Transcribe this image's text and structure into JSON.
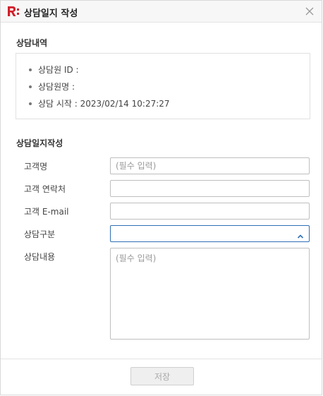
{
  "window": {
    "title": "상담일지 작성",
    "logo_icon": "r-logo-icon",
    "close_icon": "close-icon",
    "brand_color": "#d0202a",
    "accent_color": "#2f6fb5"
  },
  "consult_info": {
    "section_title": "상담내역",
    "items": [
      "상담원 ID :",
      "상담원명 :",
      "상담 시작 : 2023/02/14 10:27:27"
    ]
  },
  "consult_form": {
    "section_title": "상담일지작성",
    "customer_name": {
      "label": "고객명",
      "value": "",
      "placeholder": "(필수 입력)"
    },
    "customer_contact": {
      "label": "고객 연락처",
      "value": "",
      "placeholder": ""
    },
    "customer_email": {
      "label": "고객 E-mail",
      "value": "",
      "placeholder": ""
    },
    "consult_category": {
      "label": "상담구분",
      "value": "",
      "icon": "chevron-up-icon"
    },
    "consult_content": {
      "label": "상담내용",
      "value": "",
      "placeholder": "(필수 입력)"
    }
  },
  "footer": {
    "save_label": "저장"
  }
}
